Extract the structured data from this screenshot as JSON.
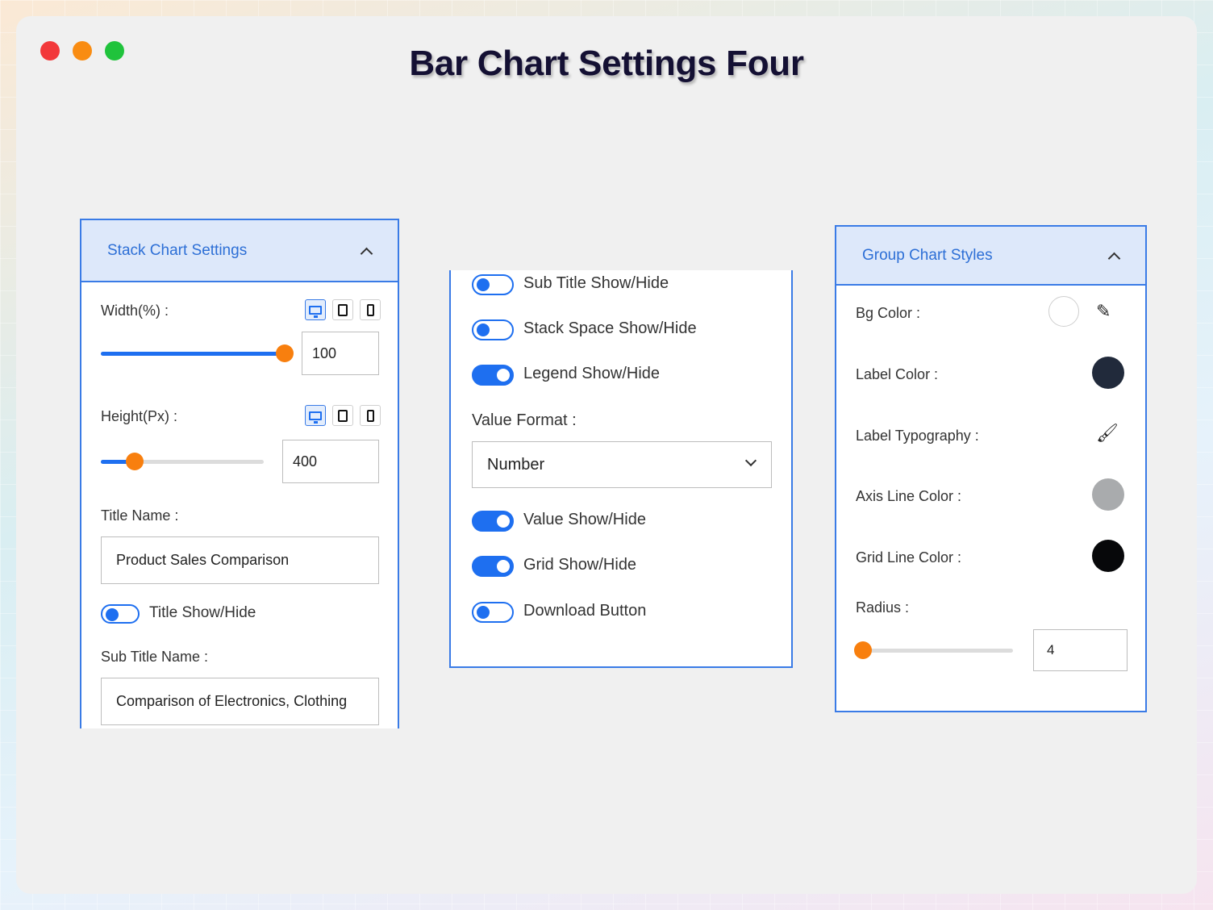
{
  "page": {
    "title": "Bar Chart Settings Four"
  },
  "stack_panel": {
    "header": "Stack Chart Settings",
    "width_label": "Width(%) :",
    "width_value": "100",
    "width_slider_fraction": 1.0,
    "height_label": "Height(Px) :",
    "height_value": "400",
    "height_slider_fraction": 0.21,
    "title_name_label": "Title Name :",
    "title_name_value": "Product Sales Comparison",
    "title_toggle_label": "Title Show/Hide",
    "title_toggle_on": false,
    "subtitle_name_label": "Sub Title Name :",
    "subtitle_name_value": "Comparison of Electronics, Clothing"
  },
  "toggles_panel": {
    "subtitle_toggle": "Sub Title Show/Hide",
    "stack_space_toggle": "Stack Space Show/Hide",
    "legend_toggle": "Legend Show/Hide",
    "value_format_label": "Value Format :",
    "value_format_selected": "Number",
    "value_toggle": "Value Show/Hide",
    "grid_toggle": "Grid Show/Hide",
    "download_toggle": "Download Button",
    "states": {
      "subtitle": false,
      "stack_space": false,
      "legend": true,
      "value": true,
      "grid": true,
      "download": false
    }
  },
  "group_panel": {
    "header": "Group Chart Styles",
    "bg_color_label": "Bg Color :",
    "label_color_label": "Label Color :",
    "label_typography_label": "Label Typography :",
    "axis_line_color_label": "Axis Line Color :",
    "grid_line_color_label": "Grid Line Color :",
    "radius_label": "Radius :",
    "radius_value": "4",
    "radius_slider_fraction": 0.0,
    "colors": {
      "bg": "#ffffff",
      "label": "#212a3b",
      "axis_line": "#a9abad",
      "grid_line": "#07080a"
    }
  },
  "theme": {
    "accent": "#1e6ff0",
    "knob": "#f87f0e",
    "header_bg": "#dde8fa",
    "header_text": "#2d6fd6"
  }
}
